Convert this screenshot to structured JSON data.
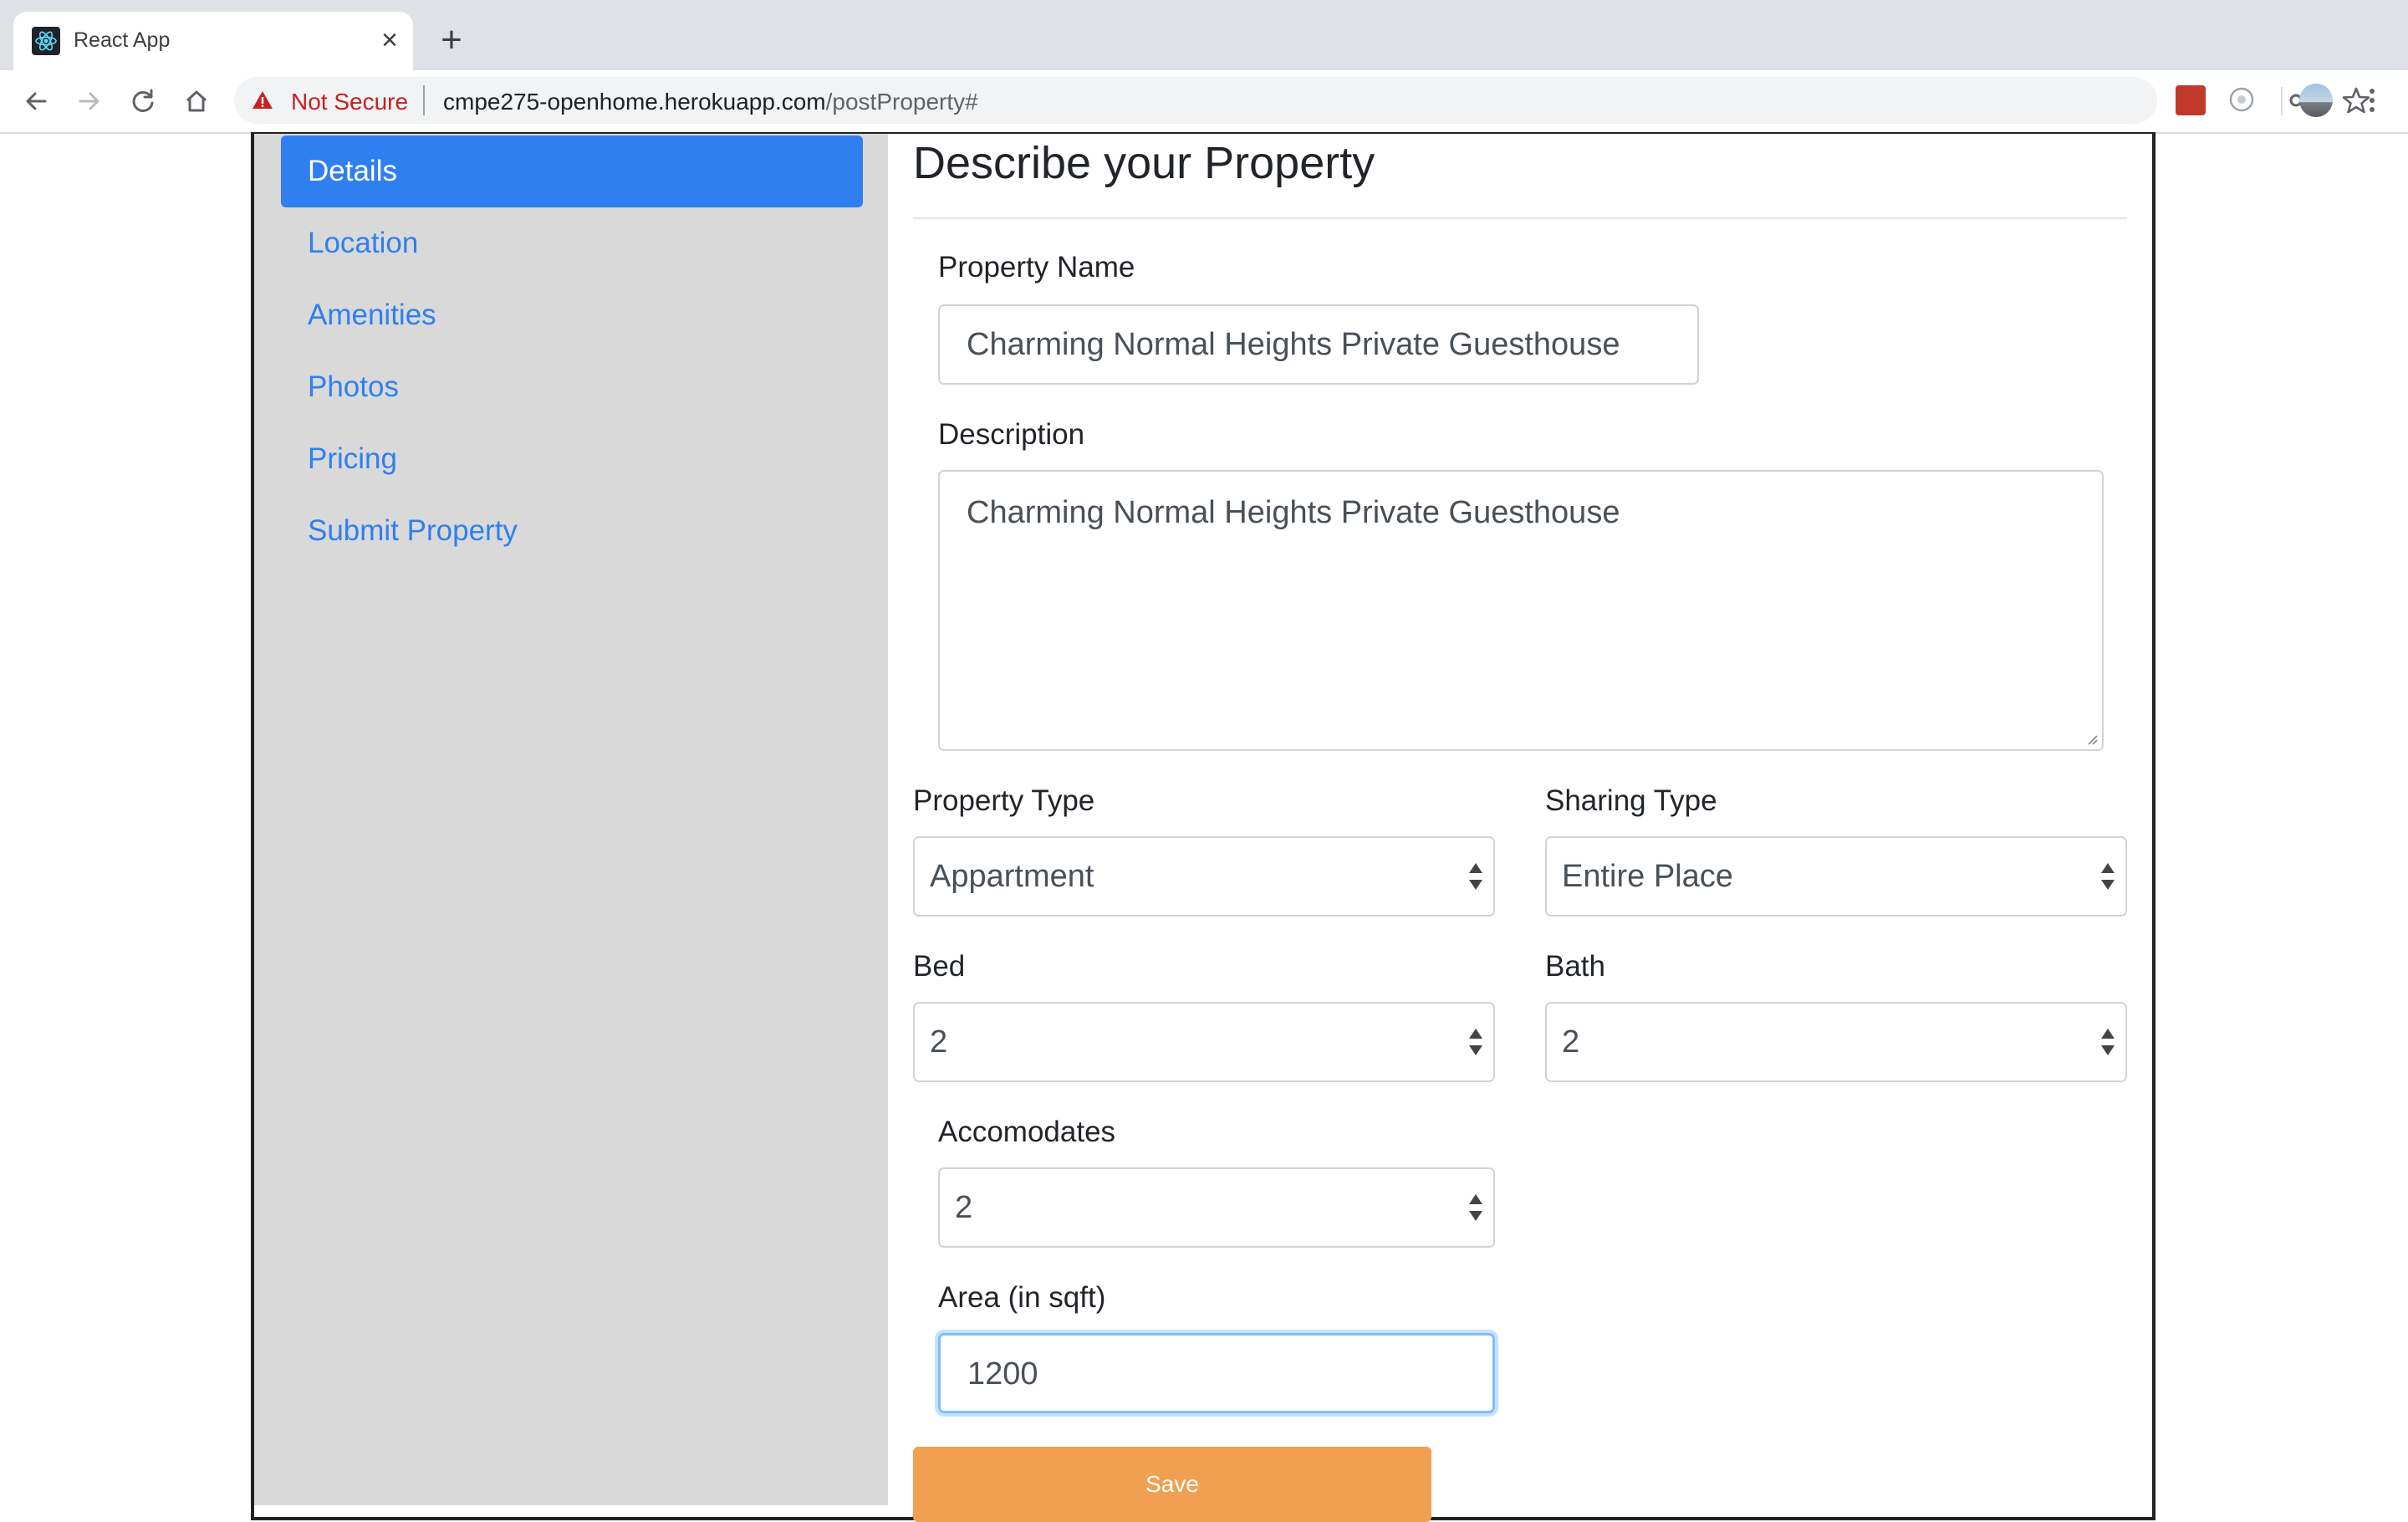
{
  "browser": {
    "tab_title": "React App",
    "not_secure_label": "Not Secure",
    "url_host": "cmpe275-openhome.herokuapp.com",
    "url_path": "/postProperty#"
  },
  "sidebar": {
    "items": [
      {
        "label": "Details",
        "active": true
      },
      {
        "label": "Location",
        "active": false
      },
      {
        "label": "Amenities",
        "active": false
      },
      {
        "label": "Photos",
        "active": false
      },
      {
        "label": "Pricing",
        "active": false
      },
      {
        "label": "Submit Property",
        "active": false
      }
    ]
  },
  "form": {
    "heading": "Describe your Property",
    "property_name": {
      "label": "Property Name",
      "value": "Charming Normal Heights Private Guesthouse"
    },
    "description": {
      "label": "Description",
      "value": "Charming Normal Heights Private Guesthouse"
    },
    "property_type": {
      "label": "Property Type",
      "value": "Appartment"
    },
    "sharing_type": {
      "label": "Sharing Type",
      "value": "Entire Place"
    },
    "bed": {
      "label": "Bed",
      "value": "2"
    },
    "bath": {
      "label": "Bath",
      "value": "2"
    },
    "accomodates": {
      "label": "Accomodates",
      "value": "2"
    },
    "area": {
      "label": "Area (in sqft)",
      "value": "1200"
    },
    "save_label": "Save"
  },
  "colors": {
    "accent": "#2f7ff0",
    "sidebar_bg": "#d9d9d9",
    "save_button": "#f0a050",
    "not_secure": "#c5221f"
  },
  "icons": [
    "react-icon",
    "close-icon",
    "plus-icon",
    "back-icon",
    "forward-icon",
    "reload-icon",
    "home-icon",
    "warning-icon",
    "key-icon",
    "star-icon",
    "extension-icon",
    "profile-avatar",
    "menu-icon"
  ]
}
